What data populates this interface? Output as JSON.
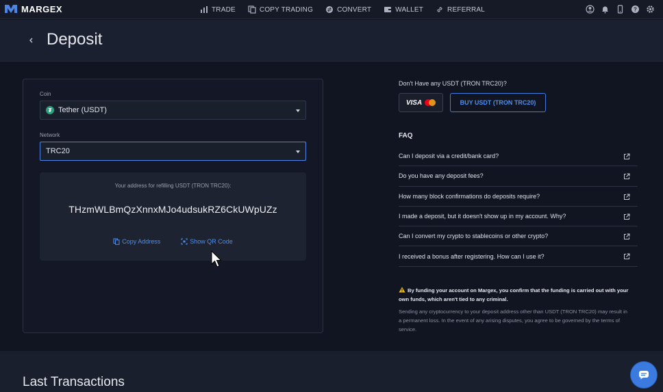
{
  "brand": {
    "name": "MARGEX"
  },
  "nav": {
    "items": [
      {
        "label": "TRADE",
        "icon": "bar-chart-icon"
      },
      {
        "label": "COPY TRADING",
        "icon": "copy-icon"
      },
      {
        "label": "CONVERT",
        "icon": "convert-icon"
      },
      {
        "label": "WALLET",
        "icon": "wallet-icon"
      },
      {
        "label": "REFERRAL",
        "icon": "link-icon"
      }
    ],
    "right_icons": [
      "user-icon",
      "bell-icon",
      "mobile-icon",
      "help-icon",
      "settings-icon"
    ]
  },
  "page": {
    "title": "Deposit"
  },
  "deposit": {
    "coin_label": "Coin",
    "coin_value": "Tether (USDT)",
    "network_label": "Network",
    "network_value": "TRC20",
    "address_caption": "Your address for refilling USDT (TRON TRC20):",
    "address": "THzmWLBmQzXnnxMJo4udsukRZ6CkUWpUZz",
    "copy_label": "Copy Address",
    "qr_label": "Show QR Code"
  },
  "buy": {
    "caption": "Don't Have any USDT (TRON TRC20)?",
    "card_label": "VISA",
    "button_label": "BUY USDT (TRON TRC20)"
  },
  "faq": {
    "title": "FAQ",
    "items": [
      "Can I deposit via a credit/bank card?",
      "Do you have any deposit fees?",
      "How many block confirmations do deposits require?",
      "I made a deposit, but it doesn't show up in my account. Why?",
      "Can I convert my crypto to stablecoins or other crypto?",
      "I received a bonus after registering. How can I use it?"
    ]
  },
  "warning": {
    "bold": "By funding your account on Margex, you confirm that the funding is carried out with your own funds, which aren't tied to any criminal.",
    "note": "Sending any cryptocurrency to your deposit address other than USDT (TRON TRC20) may result in a permanent loss. In the event of any arising disputes, you agree to be governed by the terms of service."
  },
  "transactions": {
    "title": "Last Transactions"
  },
  "colors": {
    "accent": "#4d8ff0",
    "background": "#111522",
    "tether": "#26a17b"
  }
}
